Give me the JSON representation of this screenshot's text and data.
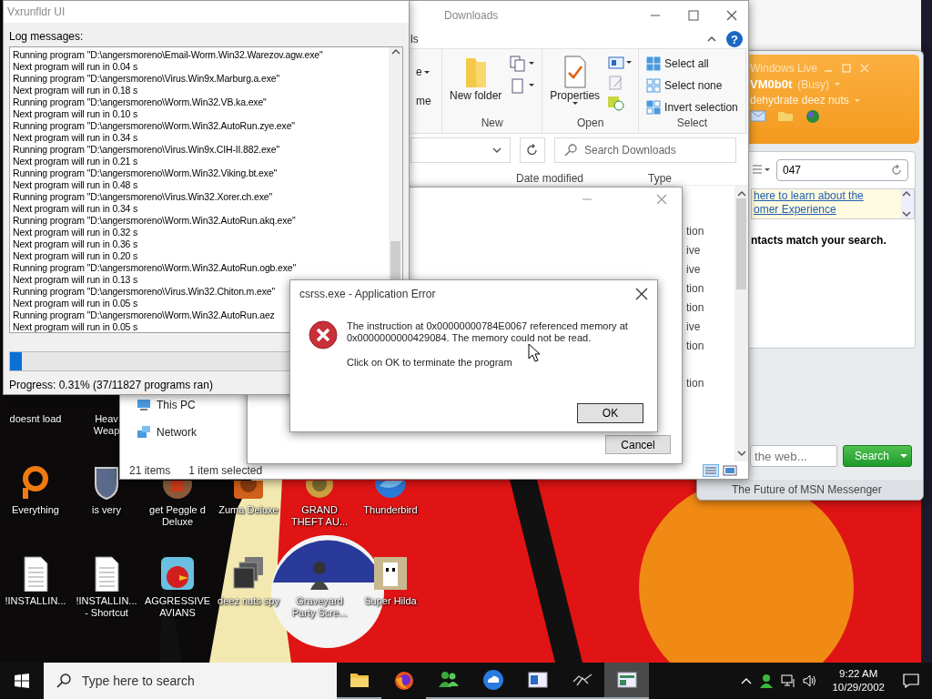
{
  "desktop_icons": [
    [
      {
        "label": "doesnt load"
      },
      {
        "label": "Heav\nWeap"
      }
    ],
    [
      {
        "label": "Everything"
      },
      {
        "label": "is very"
      },
      {
        "label": "get Peggle d\nDeluxe"
      },
      {
        "label": "Zuma Deluxe"
      },
      {
        "label": "GRAND\nTHEFT AU..."
      },
      {
        "label": "Thunderbird"
      }
    ],
    [
      {
        "label": "!INSTALLIN..."
      },
      {
        "label": "!INSTALLIN...\n- Shortcut"
      },
      {
        "label": "AGGRESSIVE\nAVIANS"
      },
      {
        "label": "deez nuts spy"
      },
      {
        "label": "Graveyard\nParty Scre..."
      },
      {
        "label": "Super Hilda"
      }
    ]
  ],
  "log_window": {
    "title": "Vxrunfldr UI",
    "log_label": "Log messages:",
    "log_lines": [
      "Running program \"D:\\angersmoreno\\Email-Worm.Win32.Warezov.agw.exe\"",
      "Next program will run in 0.04 s",
      "Running program \"D:\\angersmoreno\\Virus.Win9x.Marburg.a.exe\"",
      "Next program will run in 0.18 s",
      "Running program \"D:\\angersmoreno\\Worm.Win32.VB.ka.exe\"",
      "Next program will run in 0.10 s",
      "Running program \"D:\\angersmoreno\\Worm.Win32.AutoRun.zye.exe\"",
      "Next program will run in 0.34 s",
      "Running program \"D:\\angersmoreno\\Virus.Win9x.CIH-II.882.exe\"",
      "Next program will run in 0.21 s",
      "Running program \"D:\\angersmoreno\\Worm.Win32.Viking.bt.exe\"",
      "Next program will run in 0.48 s",
      "Running program \"D:\\angersmoreno\\Virus.Win32.Xorer.ch.exe\"",
      "Next program will run in 0.34 s",
      "Running program \"D:\\angersmoreno\\Worm.Win32.AutoRun.akq.exe\"",
      "Next program will run in 0.32 s",
      "Next program will run in 0.36 s",
      "Next program will run in 0.20 s",
      "Running program \"D:\\angersmoreno\\Worm.Win32.AutoRun.ogb.exe\"",
      "Next program will run in 0.13 s",
      "Running program \"D:\\angersmoreno\\Virus.Win32.Chiton.m.exe\"",
      "Next program will run in 0.05 s",
      "Running program \"D:\\angersmoreno\\Worm.Win32.AutoRun.aez",
      "Next program will run in 0.05 s"
    ],
    "progress": {
      "level": 0.03
    },
    "progress_text": "Progress: 0.31% (37/11827 programs ran)"
  },
  "explorer": {
    "title": "Downloads",
    "ribbon_tab": "ls",
    "help_glyph": "?",
    "ribbon_groups": [
      {
        "kind": "clipped",
        "items": [
          "e",
          "me"
        ]
      },
      {
        "kind": "new",
        "label": "New",
        "big_button": "New folder"
      },
      {
        "kind": "open",
        "label": "Open",
        "big_button": "Properties"
      },
      {
        "kind": "select",
        "label": "Select",
        "items": [
          "Select all",
          "Select none",
          "Invert selection"
        ]
      }
    ],
    "search": {
      "placeholder": "Search Downloads"
    },
    "columns": [
      "Date modified",
      "Type"
    ],
    "type_groups": [
      [
        "tion",
        "ive",
        "ive",
        "tion",
        "tion",
        "ive",
        "tion"
      ],
      [
        "tion"
      ]
    ],
    "nav_items": [
      "This PC",
      "Network"
    ],
    "status": [
      "21 items",
      "1 item selected"
    ]
  },
  "background_dialog": {
    "buttons": [
      "Cancel"
    ]
  },
  "error_dialog": {
    "title": "csrss.exe - Application Error",
    "message": "The instruction at 0x00000000784E0067 referenced memory at 0x0000000000429084. The memory could not be read.",
    "prompt": "Click on OK to terminate the program",
    "button": "OK"
  },
  "messenger": {
    "brand": "Windows Live",
    "name": "VM0b0t",
    "status": "(Busy)",
    "personal_message": "dehydrate deez nuts",
    "search_value": "047",
    "link_lines": [
      "here to learn about the",
      "omer Experience"
    ],
    "no_results": "ntacts match your search.",
    "web_search_placeholder": "the web...",
    "search_button": "Search",
    "footer": "The Future of MSN Messenger"
  },
  "taskbar": {
    "search_placeholder": "Type here to search",
    "apps": [
      {
        "running": true,
        "selected": false
      },
      {
        "running": false,
        "selected": false
      },
      {
        "running": true,
        "selected": false
      },
      {
        "running": true,
        "selected": false
      },
      {
        "running": true,
        "selected": false
      },
      {
        "running": true,
        "selected": false
      },
      {
        "running": true,
        "selected": true
      }
    ],
    "time": "9:22 AM",
    "date": "10/29/2002"
  }
}
